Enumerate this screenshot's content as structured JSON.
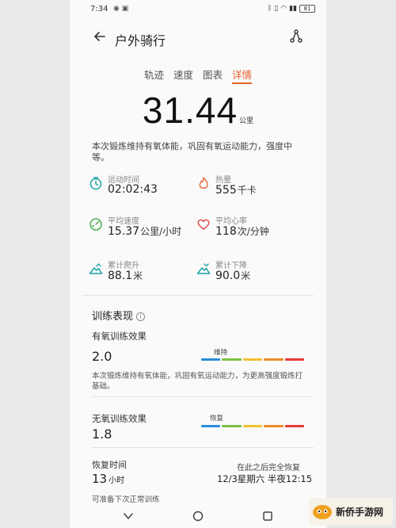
{
  "status": {
    "time": "7:34",
    "battery": "81"
  },
  "header": {
    "title": "户外骑行"
  },
  "tabs": [
    {
      "label": "轨迹"
    },
    {
      "label": "速度"
    },
    {
      "label": "图表"
    },
    {
      "label": "详情"
    }
  ],
  "distance": {
    "value": "31.44",
    "unit": "公里"
  },
  "summary": "本次锻炼维持有氧体能，巩固有氧运动能力，强度中等。",
  "metrics": [
    {
      "label": "运动时间",
      "value": "02:02:43",
      "unit": "",
      "icon": "clock-icon"
    },
    {
      "label": "热量",
      "value": "555",
      "unit": "千卡",
      "icon": "flame-icon"
    },
    {
      "label": "平均速度",
      "value": "15.37",
      "unit": "公里/小时",
      "icon": "speedometer-icon"
    },
    {
      "label": "平均心率",
      "value": "118",
      "unit": "次/分钟",
      "icon": "heart-icon"
    },
    {
      "label": "累计爬升",
      "value": "88.1",
      "unit": "米",
      "icon": "mountain-up-icon"
    },
    {
      "label": "累计下降",
      "value": "90.0",
      "unit": "米",
      "icon": "mountain-down-icon"
    }
  ],
  "training": {
    "title": "训练表现",
    "aerobic": {
      "label": "有氧训练效果",
      "value": "2.0",
      "marker": "维持",
      "desc": "本次锻炼维持有氧体能，巩固有氧运动能力，为更高强度锻炼打基础。"
    },
    "anaerobic": {
      "label": "无氧训练效果",
      "value": "1.8",
      "marker": "恢复"
    },
    "recovery": {
      "label": "恢复时间",
      "value": "13",
      "unit": "小时",
      "right_line1": "在此之后完全恢复",
      "right_line2": "12/3星期六 半夜12:15",
      "note": "可准备下次正常训练"
    },
    "scale_colors": [
      "#2a8fd8",
      "#7cc242",
      "#f2c12e",
      "#f08a2c",
      "#e53935"
    ]
  },
  "watermark": {
    "text": "新侨手游网"
  }
}
